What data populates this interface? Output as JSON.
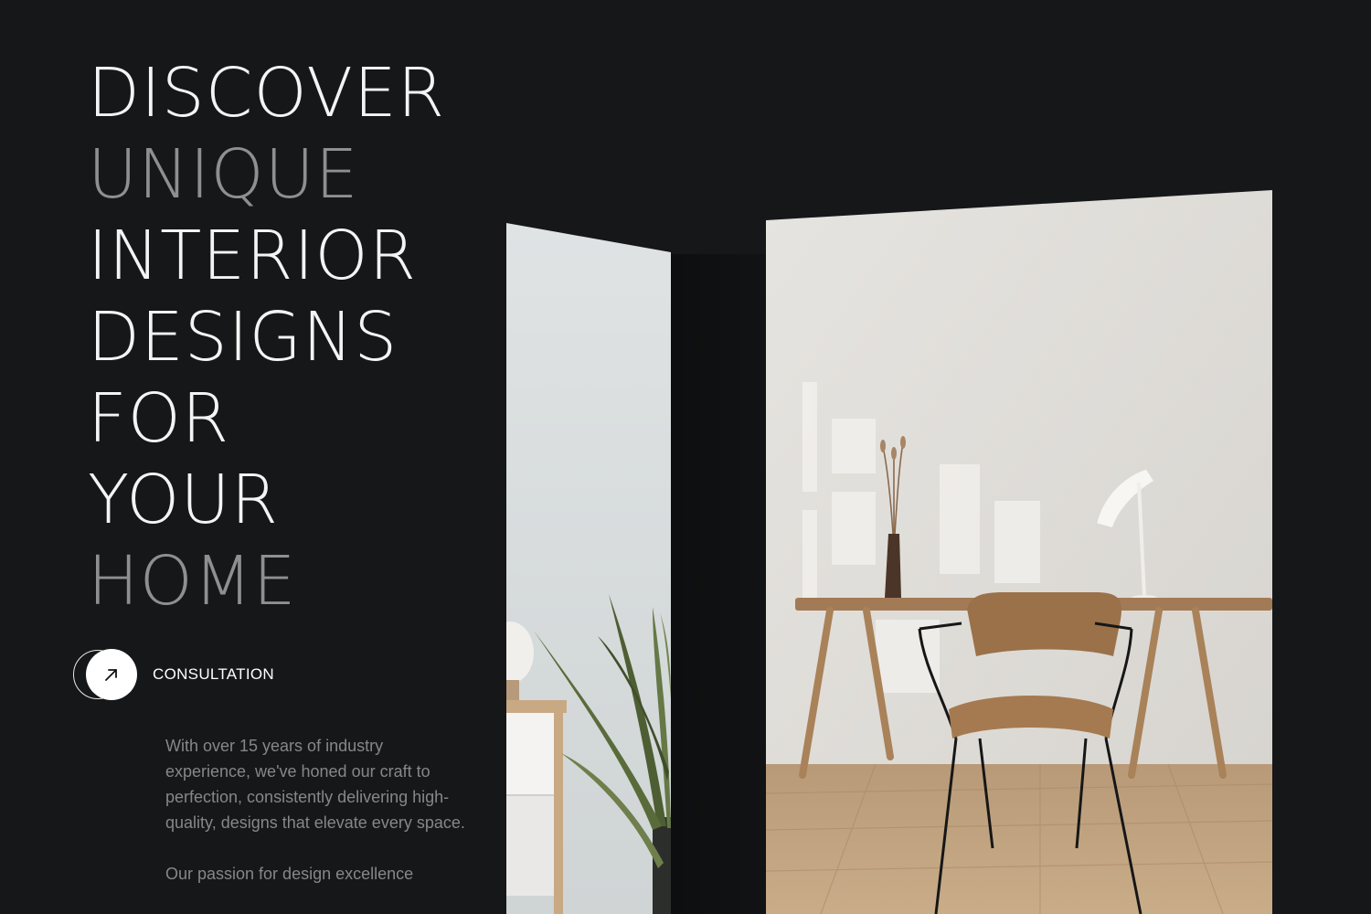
{
  "hero": {
    "headline": [
      {
        "text": "DISCOVER",
        "muted": false
      },
      {
        "text": "UNIQUE",
        "muted": true
      },
      {
        "text": "INTERIOR",
        "muted": false
      },
      {
        "text": "DESIGNS",
        "muted": false
      },
      {
        "text": "FOR",
        "muted": false
      },
      {
        "text": "YOUR",
        "muted": false
      },
      {
        "text": "HOME",
        "muted": true
      }
    ],
    "cta": {
      "label": "CONSULTATION",
      "icon": "arrow-up-right-icon"
    },
    "paragraphs": [
      "With over 15 years of industry experience, we've honed our craft to perfection, consistently delivering high-quality, designs that elevate every space.",
      "Our passion for design excellence"
    ]
  },
  "images": {
    "left": "interior-photo-plant-side-table",
    "right": "interior-photo-desk-chair-lamp"
  },
  "colors": {
    "background": "#161719",
    "headline": "#f4f4f4",
    "headline_muted": "#8f8f8f",
    "body_text": "#86878a",
    "cta_disc": "#ffffff"
  }
}
